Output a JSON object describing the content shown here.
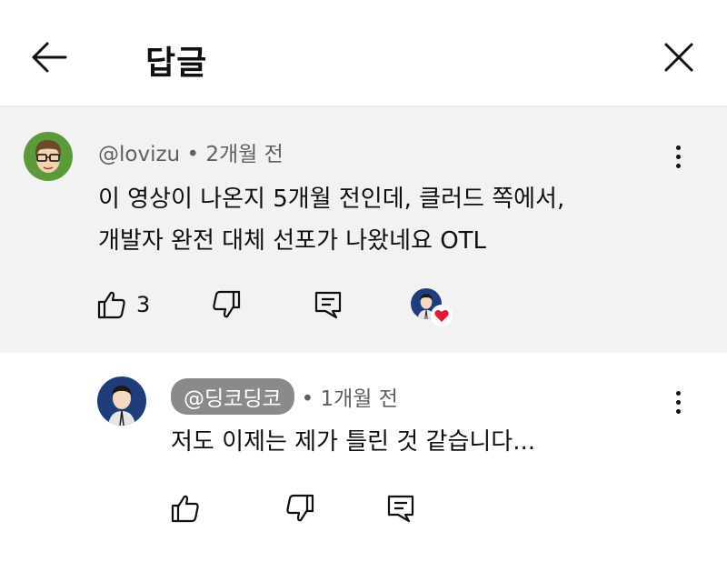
{
  "header": {
    "title": "답글",
    "back_icon": "arrow-left-icon",
    "close_icon": "close-icon"
  },
  "parent_comment": {
    "author": "@lovizu",
    "time": "• 2개월 전",
    "lines": [
      "이 영상이 나온지 5개월 전인데, 클러드 쪽에서,",
      "개발자 완전 대체 선포가 나왔네요 OTL"
    ],
    "like_count": "3",
    "creator_heart": true
  },
  "reply": {
    "author": "@딩코딩코",
    "time": "• 1개월 전",
    "text": "저도 이제는 제가 틀린 것 같습니다..."
  },
  "colors": {
    "parent_bg": "#f2f2f2",
    "meta_text": "#606060",
    "author_chip_bg": "#8a8a8a",
    "heart": "#e8173a",
    "avatar1_bg": "#5a9a3a",
    "avatar2_bg": "#1f3d7a"
  }
}
